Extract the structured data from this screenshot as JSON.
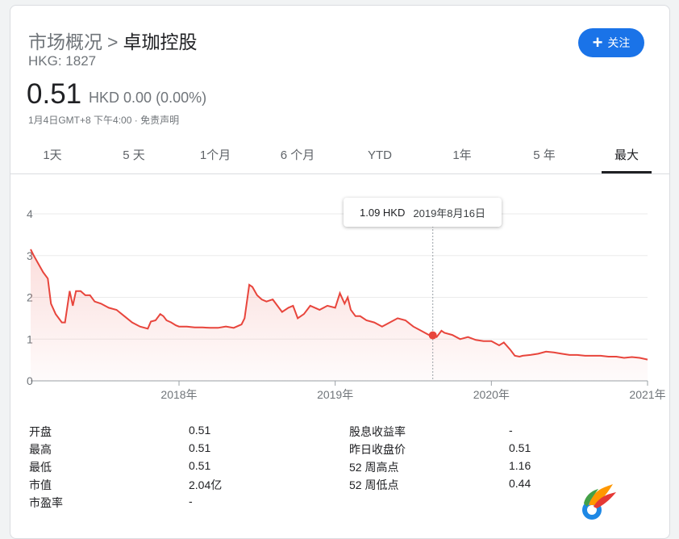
{
  "header": {
    "breadcrumb_root": "市场概况",
    "breadcrumb_sep": ">",
    "company_name": "卓珈控股",
    "ticker": "HKG: 1827",
    "follow_icon": "plus-icon",
    "follow_label": "关注"
  },
  "quote": {
    "price": "0.51",
    "currency": "HKD",
    "change": "0.00",
    "change_pct": "(0.00%)",
    "timestamp": "1月4日GMT+8 下午4:00",
    "separator": "·",
    "disclaimer": "免责声明"
  },
  "tabs": [
    {
      "label": "1天"
    },
    {
      "label": "5 天"
    },
    {
      "label": "1个月"
    },
    {
      "label": "6 个月"
    },
    {
      "label": "YTD"
    },
    {
      "label": "1年"
    },
    {
      "label": "5 年"
    },
    {
      "label": "最大"
    }
  ],
  "active_tab": 7,
  "tooltip": {
    "value": "1.09 HKD",
    "date": "2019年8月16日"
  },
  "stats": {
    "left": [
      {
        "label": "开盘",
        "value": "0.51"
      },
      {
        "label": "最高",
        "value": "0.51"
      },
      {
        "label": "最低",
        "value": "0.51"
      },
      {
        "label": "市值",
        "value": "2.04亿"
      },
      {
        "label": "市盈率",
        "value": "-"
      }
    ],
    "right": [
      {
        "label": "股息收益率",
        "value": "-"
      },
      {
        "label": "昨日收盘价",
        "value": "0.51"
      },
      {
        "label": "52 周高点",
        "value": "1.16"
      },
      {
        "label": "52 周低点",
        "value": "0.44"
      }
    ]
  },
  "colors": {
    "line": "#e8453c",
    "accent": "#1a73e8"
  },
  "chart_data": {
    "type": "area",
    "xlabel": "",
    "ylabel": "",
    "ylim": [
      0,
      4
    ],
    "yticks": [
      "0",
      "1",
      "2",
      "3",
      "4"
    ],
    "xticks": [
      "2018年",
      "2019年",
      "2020年",
      "2021年"
    ],
    "xrange": [
      2017.05,
      2021.0
    ],
    "highlight": {
      "x": 2019.625,
      "y": 1.09
    },
    "series": [
      {
        "x": [
          2017.05,
          2017.07,
          2017.1,
          2017.13,
          2017.16,
          2017.18,
          2017.21,
          2017.25,
          2017.27,
          2017.3,
          2017.32,
          2017.34,
          2017.37,
          2017.4,
          2017.43,
          2017.46,
          2017.5,
          2017.55,
          2017.6,
          2017.65,
          2017.7,
          2017.75,
          2017.8,
          2017.82,
          2017.85,
          2017.88,
          2017.9,
          2017.92,
          2017.95,
          2017.98,
          2018.0,
          2018.05,
          2018.1,
          2018.15,
          2018.2,
          2018.25,
          2018.3,
          2018.35,
          2018.4,
          2018.42,
          2018.45,
          2018.47,
          2018.5,
          2018.53,
          2018.56,
          2018.6,
          2018.63,
          2018.66,
          2018.7,
          2018.73,
          2018.76,
          2018.8,
          2018.84,
          2018.87,
          2018.9,
          2018.95,
          2019.0,
          2019.03,
          2019.06,
          2019.08,
          2019.1,
          2019.13,
          2019.16,
          2019.2,
          2019.25,
          2019.3,
          2019.35,
          2019.4,
          2019.45,
          2019.5,
          2019.55,
          2019.6,
          2019.625,
          2019.65,
          2019.68,
          2019.7,
          2019.75,
          2019.8,
          2019.85,
          2019.9,
          2019.95,
          2020.0,
          2020.05,
          2020.08,
          2020.12,
          2020.15,
          2020.18,
          2020.2,
          2020.25,
          2020.3,
          2020.35,
          2020.4,
          2020.45,
          2020.5,
          2020.55,
          2020.6,
          2020.65,
          2020.7,
          2020.75,
          2020.8,
          2020.85,
          2020.9,
          2020.95,
          2021.0
        ],
        "values": [
          3.15,
          3.0,
          2.8,
          2.6,
          2.45,
          1.85,
          1.6,
          1.4,
          1.4,
          2.15,
          1.8,
          2.15,
          2.15,
          2.05,
          2.05,
          1.9,
          1.85,
          1.75,
          1.7,
          1.55,
          1.4,
          1.3,
          1.25,
          1.42,
          1.45,
          1.6,
          1.55,
          1.45,
          1.4,
          1.33,
          1.3,
          1.3,
          1.28,
          1.28,
          1.27,
          1.27,
          1.3,
          1.27,
          1.35,
          1.5,
          2.3,
          2.25,
          2.05,
          1.95,
          1.9,
          1.95,
          1.8,
          1.65,
          1.75,
          1.8,
          1.5,
          1.6,
          1.8,
          1.75,
          1.7,
          1.8,
          1.75,
          2.1,
          1.85,
          2.0,
          1.7,
          1.55,
          1.55,
          1.45,
          1.4,
          1.3,
          1.4,
          1.5,
          1.45,
          1.3,
          1.2,
          1.1,
          1.09,
          1.05,
          1.2,
          1.15,
          1.1,
          1.0,
          1.05,
          0.98,
          0.95,
          0.95,
          0.85,
          0.92,
          0.75,
          0.6,
          0.58,
          0.6,
          0.62,
          0.65,
          0.7,
          0.68,
          0.65,
          0.62,
          0.62,
          0.6,
          0.6,
          0.6,
          0.58,
          0.58,
          0.55,
          0.57,
          0.55,
          0.51
        ]
      }
    ]
  }
}
